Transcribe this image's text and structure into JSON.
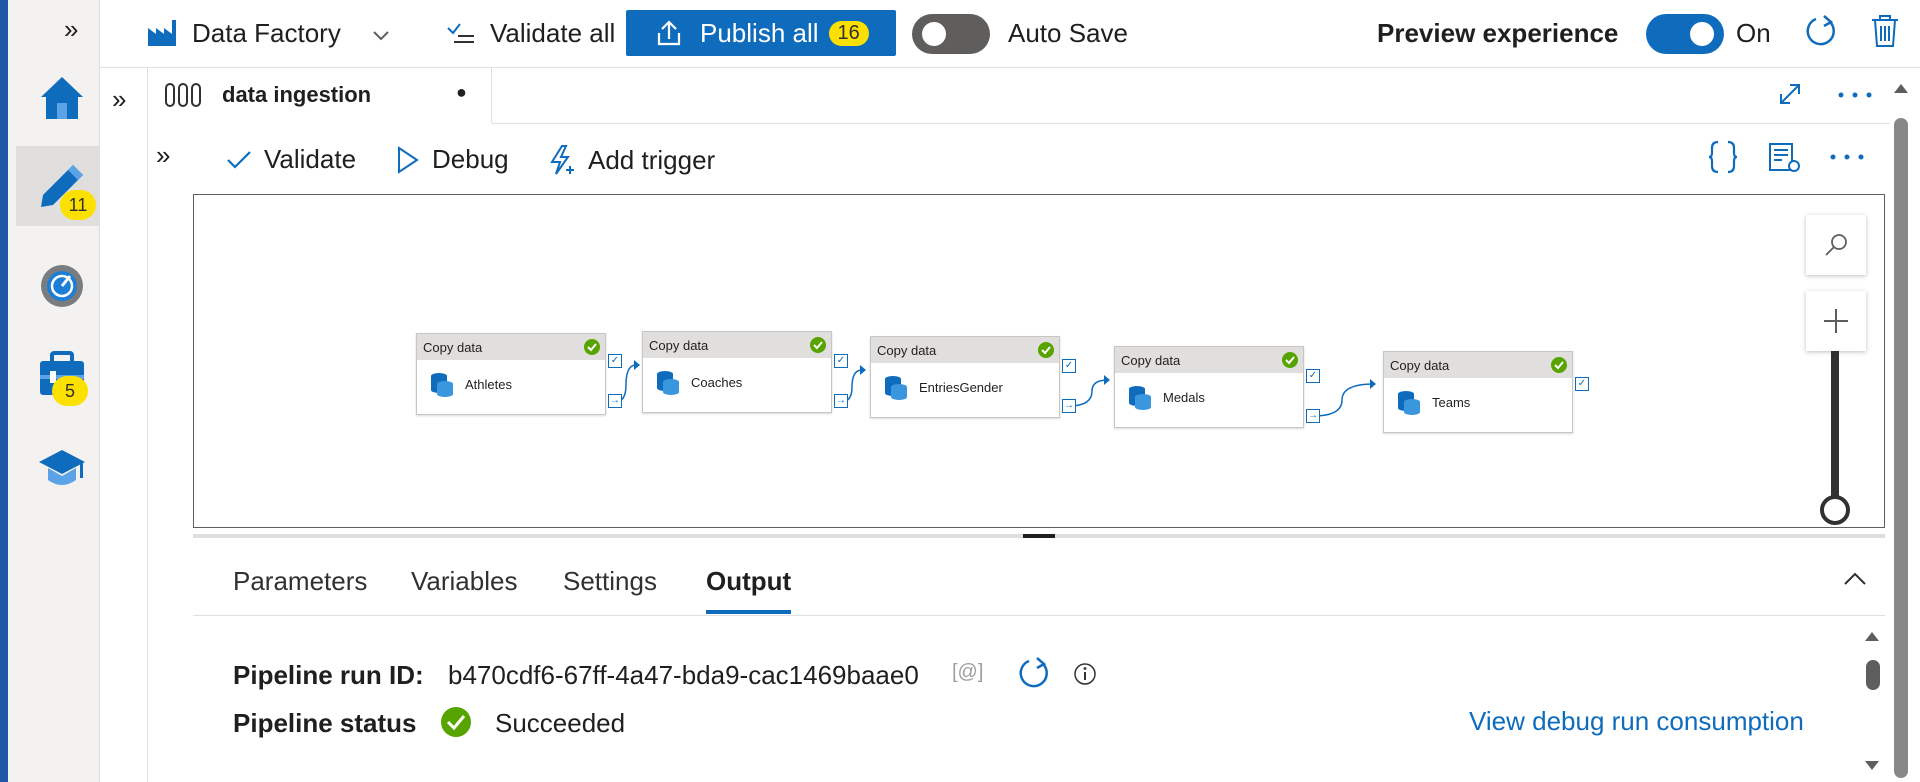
{
  "topbar": {
    "expand_icon": "»",
    "factory_label": "Data Factory",
    "validate_all_label": "Validate all",
    "publish_label": "Publish all",
    "publish_count": "16",
    "autosave_label": "Auto Save",
    "autosave_on": false,
    "preview_label": "Preview experience",
    "preview_toggle_on": true,
    "preview_state_label": "On"
  },
  "left_rail": {
    "items": [
      {
        "name": "home",
        "icon": "home-icon"
      },
      {
        "name": "author",
        "icon": "pencil-icon",
        "badge": "11",
        "active": true
      },
      {
        "name": "monitor",
        "icon": "gauge-icon"
      },
      {
        "name": "manage",
        "icon": "toolbox-icon",
        "badge": "5"
      },
      {
        "name": "learning",
        "icon": "graduation-cap-icon"
      }
    ]
  },
  "side_panel": {
    "expand_icon": "»"
  },
  "tab": {
    "title": "data ingestion",
    "unsaved_dot": "●"
  },
  "pipeline_toolbar": {
    "validate_label": "Validate",
    "debug_label": "Debug",
    "add_trigger_label": "Add trigger"
  },
  "canvas": {
    "activities": [
      {
        "type": "Copy data",
        "name": "Athletes"
      },
      {
        "type": "Copy data",
        "name": "Coaches"
      },
      {
        "type": "Copy data",
        "name": "EntriesGender"
      },
      {
        "type": "Copy data",
        "name": "Medals"
      },
      {
        "type": "Copy data",
        "name": "Teams"
      }
    ],
    "port_success": "✓",
    "port_next": "→"
  },
  "bottom_panel": {
    "tabs": [
      {
        "label": "Parameters",
        "active": false
      },
      {
        "label": "Variables",
        "active": false
      },
      {
        "label": "Settings",
        "active": false
      },
      {
        "label": "Output",
        "active": true
      }
    ],
    "run_id_label": "Pipeline run ID:",
    "run_id_value": "b470cdf6-67ff-4a47-bda9-cac1469baae0",
    "copy_icon_text": "[@]",
    "status_label": "Pipeline status",
    "status_value": "Succeeded",
    "debug_consumption_link": "View debug run consumption"
  },
  "colors": {
    "accent": "#0f6cbd",
    "success": "#57a300",
    "badge": "#fce100",
    "rail_border": "#2156a5"
  }
}
